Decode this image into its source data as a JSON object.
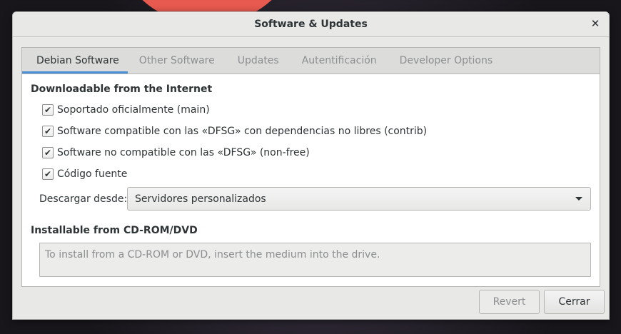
{
  "window": {
    "title": "Software & Updates"
  },
  "tabs": [
    {
      "label": "Debian Software",
      "active": true
    },
    {
      "label": "Other Software",
      "active": false
    },
    {
      "label": "Updates",
      "active": false
    },
    {
      "label": "Autentificación",
      "active": false
    },
    {
      "label": "Developer Options",
      "active": false
    }
  ],
  "internet": {
    "heading": "Downloadable from the Internet",
    "options": [
      {
        "label": "Soportado oficialmente (main)",
        "checked": true
      },
      {
        "label": "Software compatible con las «DFSG» con dependencias no libres (contrib)",
        "checked": true
      },
      {
        "label": "Software no compatible con las «DFSG» (non-free)",
        "checked": true
      },
      {
        "label": "Código fuente",
        "checked": true
      }
    ],
    "download_from_label": "Descargar desde:",
    "download_from_value": "Servidores personalizados"
  },
  "cdrom": {
    "heading": "Installable from CD-ROM/DVD",
    "message": "To install from a CD-ROM or DVD, insert the medium into the drive."
  },
  "buttons": {
    "revert": "Revert",
    "close": "Cerrar"
  },
  "icons": {
    "close": "close-icon",
    "check": "checkmark-icon",
    "dropdown": "chevron-down-icon"
  },
  "colors": {
    "accent": "#4a90d9"
  }
}
